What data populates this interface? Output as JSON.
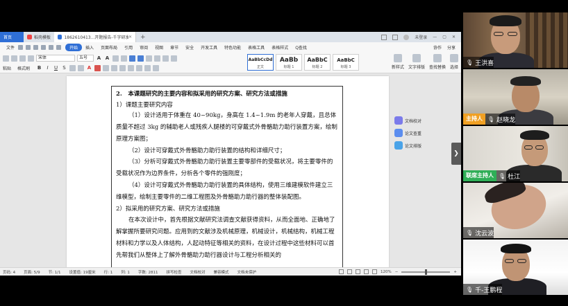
{
  "wps": {
    "tabs": [
      {
        "label": "首页"
      },
      {
        "label": "稻壳模板"
      },
      {
        "label": "1862610413...开题报告-千字研发者"
      }
    ],
    "tab_add": "+",
    "login_label": "未登录",
    "ribbon_tabs": [
      "文件",
      "开始",
      "插入",
      "页面布局",
      "引用",
      "审阅",
      "视图",
      "章节",
      "安全",
      "开发工具",
      "特色功能",
      "表格工具",
      "表格样式",
      "Q查找"
    ],
    "ribbon_active_index": 1,
    "ribbon_right": [
      "协作",
      "分享"
    ],
    "font_name": "宋体",
    "font_size": "五号",
    "styles": [
      {
        "preview": "AaBbCcDd",
        "label": "正文"
      },
      {
        "preview": "AaBb",
        "label": "标题 1"
      },
      {
        "preview": "AaBbC",
        "label": "标题 2"
      },
      {
        "preview": "AaBbC",
        "label": "标题 3"
      }
    ],
    "ribbon_groups": [
      "新样式",
      "文字排版",
      "查找替换",
      "选择"
    ],
    "paste_label": "粘贴",
    "format_painter_label": "格式刷",
    "document": {
      "heading": "2.　本课题研究的主要内容和拟采用的研究方案、研究方法或措施",
      "sub1": "1）课题主要研究内容",
      "p1": "（1）设计适用于体重在 40~90kg，身高在 1.4~1.9m 的老年人穿戴，且总体质量不超过 3kg 的辅助老人或残疾人腿楼的可穿戴式外骨骼助力助行装置方案，绘制原理方案图；",
      "p2": "（2）设计可穿戴式外骨骼助力助行装置的结构和详细尺寸；",
      "p3": "（3）分析可穿戴式外骨骼助力助行装置主要零部件的受载状况，将主要零件的受载状况作为边界条件，分析各个零件的强刚度；",
      "p4": "（4）设计可穿戴式外骨骼助力助行装置的具体结构，使用三维建模软件建立三维模型，绘制主要零件的二维工程图及外骨骼助力助行器的整体装配图。",
      "sub2": "2）拟采用的研究方案、研究方法或措施",
      "p5": "在本次设计中，首先根据文献研究法调查文献获得资料，从而全面地、正确地了解掌握所要研究问题。应用到的文献涉及机械原理，机械设计，机械结构，机械工程材料和力学以及人体结构，人起动特征等相关的资料，在设计过程中这些材料可以首先帮我们从整体上了解外骨骼助力助行器设计与工程分析相关的"
    },
    "side_float": [
      {
        "label": "文档校对"
      },
      {
        "label": "论文查重"
      },
      {
        "label": "论文排版"
      }
    ],
    "status": {
      "page": "页码: 4",
      "pages": "页面: 5/9",
      "section": "节: 1/1",
      "position": "设置值: 19厘米",
      "row": "行: 1",
      "col": "列: 1",
      "words": "字数: 2811",
      "spell": "拼写检查",
      "doc_check": "文档校对",
      "compat": "兼容模式",
      "protect": "文档未保护",
      "zoom": "120%",
      "zoom_fraction": 0.5
    }
  },
  "participants": [
    {
      "name": "王洪喜",
      "badge": "",
      "mic": "on"
    },
    {
      "name": "赵晓龙",
      "badge": "主持人",
      "mic": "on"
    },
    {
      "name": "杜江",
      "badge": "联席主持人",
      "mic": "on"
    },
    {
      "name": "沈云波",
      "badge": "",
      "mic": "on"
    },
    {
      "name": "千-王鹏程",
      "badge": "",
      "mic": "on"
    }
  ],
  "colors": {
    "accent": "#2f6fd6",
    "host_badge": "#f0a023",
    "cohost_badge": "#2fae57"
  }
}
